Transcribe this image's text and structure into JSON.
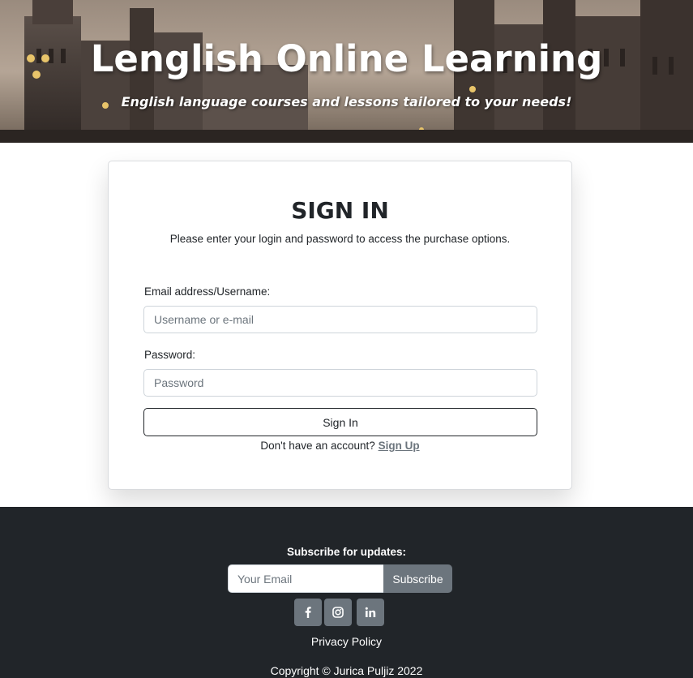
{
  "header": {
    "title": "Lenglish Online Learning",
    "subtitle": "English language courses and lessons tailored to your needs!"
  },
  "signin": {
    "title": "SIGN IN",
    "description": "Please enter your login and password to access the purchase options.",
    "email_label": "Email address/Username:",
    "email_placeholder": "Username or e-mail",
    "email_value": "",
    "password_label": "Password:",
    "password_placeholder": "Password",
    "password_value": "",
    "button_label": "Sign In",
    "signup_prompt": "Don't have an account?",
    "signup_link": "Sign Up"
  },
  "footer": {
    "subscribe_label": "Subscribe for updates:",
    "email_placeholder": "Your Email",
    "subscribe_button": "Subscribe",
    "social": [
      {
        "name": "facebook-icon",
        "glyph": "f"
      },
      {
        "name": "instagram-icon",
        "glyph": ""
      },
      {
        "name": "linkedin-icon",
        "glyph": "in"
      }
    ],
    "privacy_link": "Privacy Policy",
    "copyright": "Copyright © Jurica Puljiz 2022"
  },
  "colors": {
    "footer_bg": "#212529",
    "button_secondary": "#6c757d",
    "text_primary": "#212529"
  }
}
